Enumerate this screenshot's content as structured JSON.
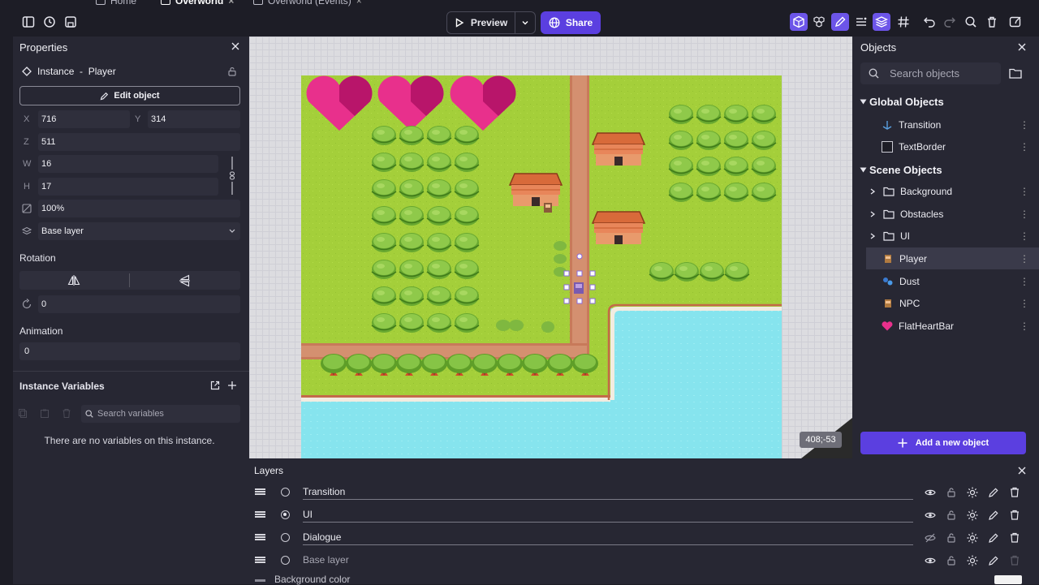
{
  "toolbar": {
    "tabs": [
      {
        "label": "Home"
      },
      {
        "label": "Overworld"
      },
      {
        "label": "Overworld (Events)"
      }
    ],
    "preview_label": "Preview",
    "share_label": "Share",
    "accent_color": "#5b3fe0"
  },
  "properties": {
    "title": "Properties",
    "instance_title": "Instance  -  Player",
    "edit_object_label": "Edit object",
    "x_label": "X",
    "x_value": "716",
    "y_label": "Y",
    "y_value": "314",
    "z_label": "Z",
    "z_value": "511",
    "w_label": "W",
    "w_value": "16",
    "h_label": "H",
    "h_value": "17",
    "opacity_value": "100%",
    "layer_value": "Base layer",
    "rotation_label": "Rotation",
    "rotation_value": "0",
    "animation_label": "Animation",
    "animation_value": "0",
    "instance_variables_label": "Instance Variables",
    "search_variables_placeholder": "Search variables",
    "no_variables_text": "There are no variables on this instance."
  },
  "objects": {
    "title": "Objects",
    "search_placeholder": "Search objects",
    "global_title": "Global Objects",
    "global_items": [
      {
        "label": "Transition",
        "icon": "transition-icon"
      },
      {
        "label": "TextBorder",
        "icon": "textborder-icon"
      }
    ],
    "scene_title": "Scene Objects",
    "scene_folders": [
      {
        "label": "Background"
      },
      {
        "label": "Obstacles"
      },
      {
        "label": "UI"
      }
    ],
    "scene_items": [
      {
        "label": "Player",
        "icon": "player-icon",
        "selected": true
      },
      {
        "label": "Dust",
        "icon": "dust-icon"
      },
      {
        "label": "NPC",
        "icon": "npc-icon"
      },
      {
        "label": "FlatHeartBar",
        "icon": "heart-icon"
      }
    ],
    "add_object_label": "Add a new object"
  },
  "canvas": {
    "coordinates": "408;-53"
  },
  "layers": {
    "title": "Layers",
    "items": [
      {
        "name": "Transition",
        "active": false,
        "visible": true
      },
      {
        "name": "UI",
        "active": true,
        "visible": true
      },
      {
        "name": "Dialogue",
        "active": false,
        "visible": false
      },
      {
        "name": "Base layer",
        "active": false,
        "visible": true
      }
    ],
    "background_color_label": "Background color"
  }
}
